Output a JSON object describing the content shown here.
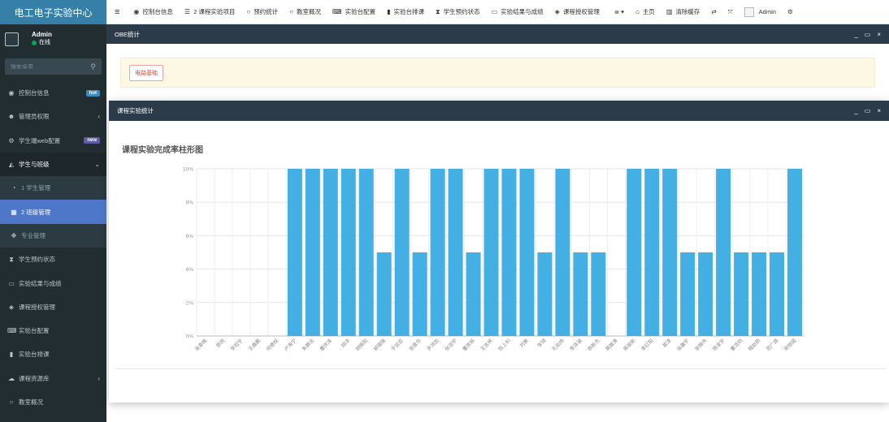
{
  "app": {
    "title": "电工电子实验中心"
  },
  "user": {
    "name": "Admin",
    "status": "在线"
  },
  "sidebar": {
    "search_placeholder": "搜索菜单",
    "items": [
      {
        "label": "控制台信息",
        "icon": "dashboard-icon",
        "glyph": "◉",
        "badge": "hot"
      },
      {
        "label": "管理员权限",
        "icon": "users-icon",
        "glyph": "☻",
        "chevron": "‹"
      },
      {
        "label": "学生端web配置",
        "icon": "cogs-icon",
        "glyph": "⚙",
        "badge": "new"
      },
      {
        "label": "学生与班级",
        "icon": "graduation-cap-icon",
        "glyph": "◭",
        "chevron": "⌄",
        "open": true
      },
      {
        "label": "1 学生管理",
        "icon": "user-circle-icon",
        "glyph": "◔",
        "sub": true
      },
      {
        "label": "2 班级管理",
        "icon": "grid-icon",
        "glyph": "▦",
        "sub": true,
        "active": true
      },
      {
        "label": "专业管理",
        "icon": "crosshair-icon",
        "glyph": "✥",
        "sub": true
      },
      {
        "label": "学生预约状态",
        "icon": "hourglass-icon",
        "glyph": "⧗"
      },
      {
        "label": "实验结果与成绩",
        "icon": "monitor-icon",
        "glyph": "▭"
      },
      {
        "label": "课程授权管理",
        "icon": "tag-icon",
        "glyph": "◈"
      },
      {
        "label": "实验台配置",
        "icon": "keyboard-icon",
        "glyph": "⌨"
      },
      {
        "label": "实验台排课",
        "icon": "battery-icon",
        "glyph": "▮"
      },
      {
        "label": "课程资源库",
        "icon": "cloud-icon",
        "glyph": "☁",
        "chevron": "‹"
      },
      {
        "label": "教室概况",
        "icon": "circle-icon",
        "glyph": "○"
      }
    ]
  },
  "topnav": {
    "menu_toggle_glyph": "≡",
    "items": [
      {
        "label": "控制台信息",
        "icon": "dashboard-icon",
        "glyph": "◉"
      },
      {
        "label": "2 课程实验项目",
        "icon": "list-icon",
        "glyph": "☰"
      },
      {
        "label": "预约统计",
        "icon": "circle-icon",
        "glyph": "○"
      },
      {
        "label": "教室概况",
        "icon": "circle-icon",
        "glyph": "○"
      },
      {
        "label": "实验台配置",
        "icon": "keyboard-icon",
        "glyph": "⌨"
      },
      {
        "label": "实验台排课",
        "icon": "battery-icon",
        "glyph": "▮"
      },
      {
        "label": "学生预约状态",
        "icon": "hourglass-icon",
        "glyph": "⧗"
      },
      {
        "label": "实验结果与成绩",
        "icon": "monitor-icon",
        "glyph": "▭"
      },
      {
        "label": "课程授权管理",
        "icon": "tag-icon",
        "glyph": "◈"
      }
    ],
    "more_glyph": "≣ ▾",
    "home_label": "主页",
    "clear_cache_label": "清除缓存",
    "admin_label": "Admin"
  },
  "outer_window": {
    "title": "OBE统计",
    "course_button": "电路基础",
    "controls": [
      "_",
      "▭",
      "×"
    ]
  },
  "inner_window": {
    "title": "课程实验统计",
    "controls": [
      "_",
      "▭",
      "×"
    ]
  },
  "chart_data": {
    "type": "bar",
    "title": "课程实验完成率柱形图",
    "ylim": [
      0,
      10
    ],
    "yticks": [
      "0%",
      "2%",
      "4%",
      "6%",
      "8%",
      "10%"
    ],
    "grid": true,
    "color": "#44afe2",
    "categories": [
      "张泰格",
      "郭雨",
      "李冠宇",
      "王鑫鹏",
      "何德权",
      "卢海宁",
      "朱静洁",
      "董庆泽",
      "胡洋",
      "胡振阳",
      "郝瑞瑞",
      "于廷臣",
      "张晋华",
      "尹鸿志",
      "张润宇",
      "董彦辰",
      "王吉祥",
      "陈上利",
      "刘景",
      "李琦",
      "孔佑炜",
      "李泽涵",
      "杨新杰",
      "高雄涛",
      "蒋丽新",
      "李红阳",
      "裴淳",
      "张震宇",
      "张锦伟",
      "杨凌宇",
      "董浩钧",
      "程赵扬",
      "范广源",
      "宋晓斌"
    ],
    "values": [
      0,
      0,
      0,
      0,
      0,
      10,
      10,
      10,
      10,
      10,
      5,
      10,
      5,
      10,
      10,
      5,
      10,
      10,
      10,
      5,
      10,
      5,
      5,
      0,
      10,
      10,
      10,
      5,
      5,
      10,
      5,
      5,
      5,
      10
    ]
  }
}
